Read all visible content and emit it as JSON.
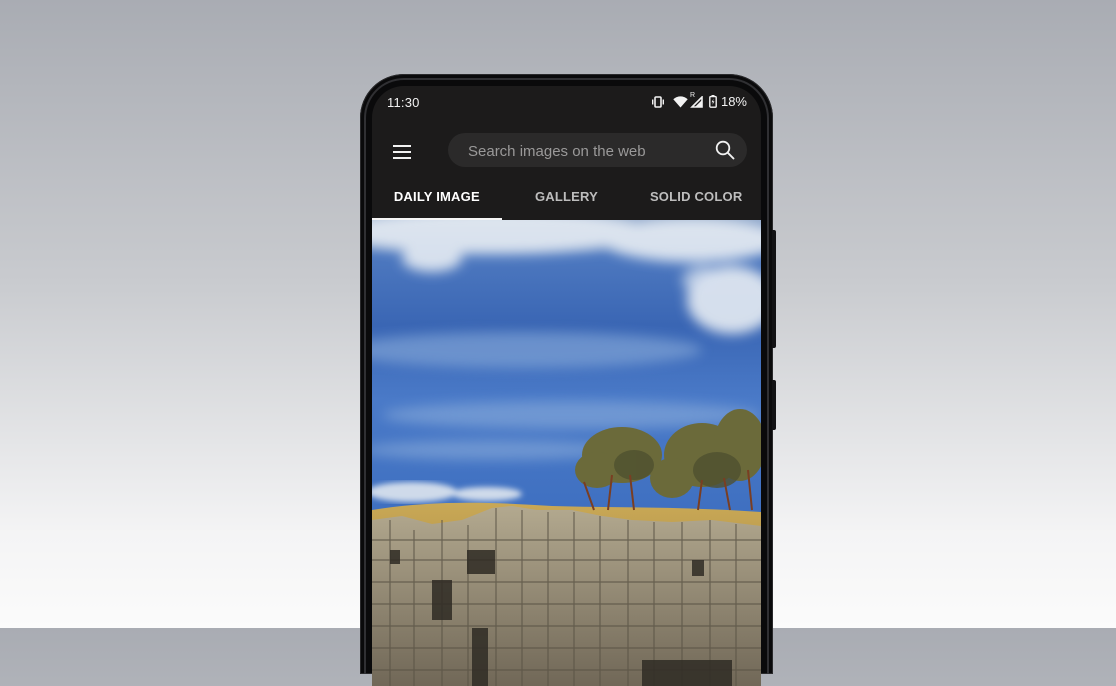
{
  "status_bar": {
    "time": "11:30",
    "icons": [
      "vibrate-icon",
      "wifi-icon",
      "signal-roaming-icon",
      "battery-charging-icon"
    ],
    "roaming_label": "R",
    "battery_percent": "18%"
  },
  "app_bar": {
    "menu_icon": "hamburger-menu-icon",
    "search": {
      "placeholder": "Search images on the web",
      "value": "",
      "icon": "search-icon"
    }
  },
  "tabs": [
    {
      "label": "DAILY IMAGE",
      "active": true
    },
    {
      "label": "GALLERY",
      "active": false
    },
    {
      "label": "SOLID COLOR",
      "active": false
    }
  ],
  "daily_image": {
    "description": "Stone ruins under a blue cloudy sky with trees on a grassy hill"
  },
  "colors": {
    "app_background": "#1c1b1b",
    "search_background": "#2b2a2a",
    "tab_indicator": "#f5f5f5",
    "sky_blue": "#3d6fc2"
  }
}
